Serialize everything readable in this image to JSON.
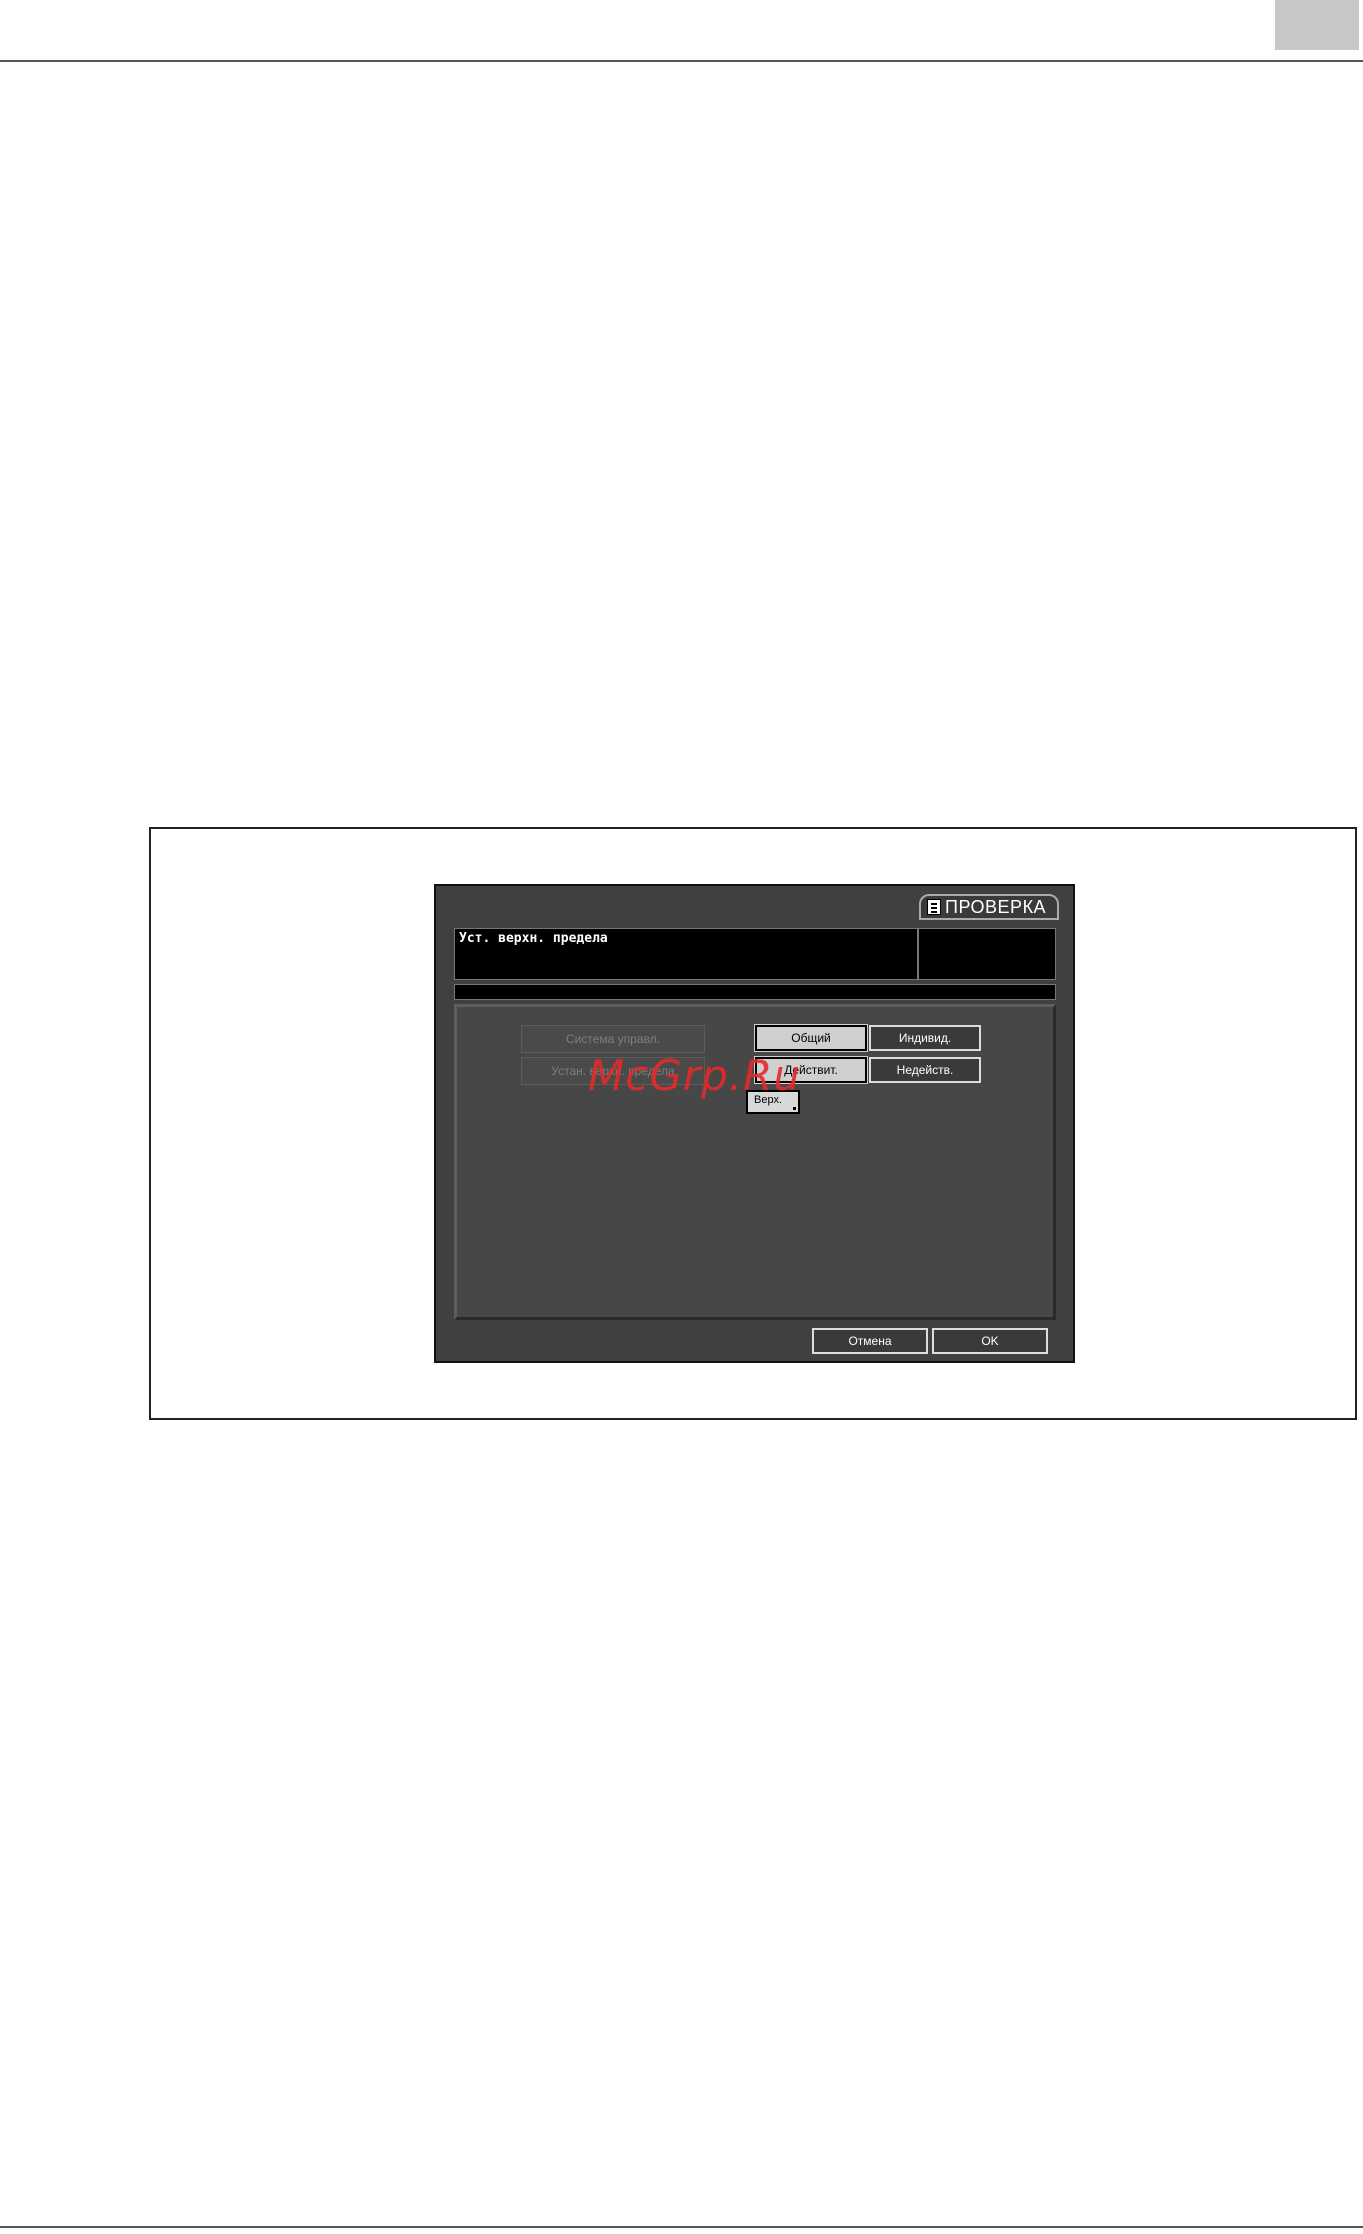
{
  "screen": {
    "tab_label": "ПРОВЕРКА",
    "header_title": "Уст. верхн. предела",
    "menu": {
      "system_label": "Система управл.",
      "upper_limit_label": "Устан. верхн. предела"
    },
    "options_row1": {
      "common": "Общий",
      "individual": "Индивид."
    },
    "options_row2": {
      "active": "Действит.",
      "inactive": "Недейств."
    },
    "upper_button": "Верх.",
    "footer": {
      "cancel": "Отмена",
      "ok": "OK"
    }
  },
  "watermark": "McGrp.Ru"
}
